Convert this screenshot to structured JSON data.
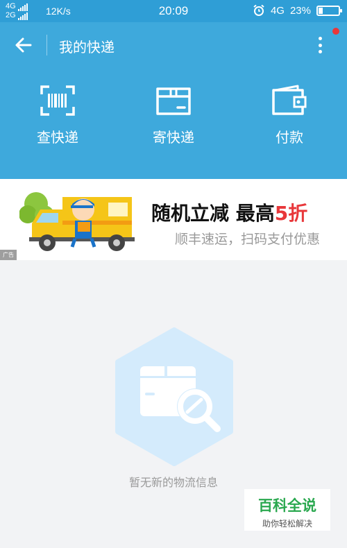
{
  "status_bar": {
    "net_top": "4G",
    "net_bottom": "2G",
    "speed": "12K/s",
    "time": "20:09",
    "net_right": "4G",
    "battery": "23%",
    "battery_level": 0.23
  },
  "header": {
    "title": "我的快递",
    "back_icon": "arrow-left-icon",
    "more_icon": "more-vertical-icon",
    "notification_color": "#e8373a"
  },
  "actions": [
    {
      "label": "查快递",
      "icon": "barcode-scan-icon"
    },
    {
      "label": "寄快递",
      "icon": "box-icon"
    },
    {
      "label": "付款",
      "icon": "wallet-icon"
    }
  ],
  "ad": {
    "headline_main": "随机立减 最高",
    "headline_highlight": "5折",
    "subtitle": "顺丰速运，扫码支付优惠",
    "tag": "广告",
    "image": "delivery-truck-illustration"
  },
  "empty_state": {
    "message": "暂无新的物流信息",
    "icon": "package-search-icon"
  },
  "watermark": {
    "title": "百科全说",
    "subtitle": "助你轻松解决"
  },
  "colors": {
    "header_bg": "#3ea9dc",
    "status_bg": "#2f9ed6",
    "accent_red": "#e8373a",
    "page_bg": "#f2f3f5"
  }
}
